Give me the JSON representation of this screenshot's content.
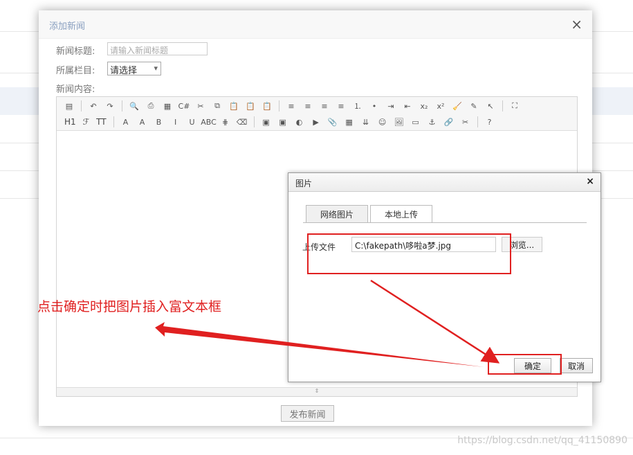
{
  "modal": {
    "title": "添加新闻",
    "close": "×",
    "title_label": "新闻标题:",
    "title_placeholder": "请输入新闻标题",
    "category_label": "所属栏目:",
    "category_selected": "请选择",
    "content_label": "新闻内容:",
    "submit_label": "发布新闻"
  },
  "toolbar": {
    "row1_icons": [
      "source-icon",
      "undo-icon",
      "redo-icon",
      "preview-icon",
      "print-icon",
      "template-icon",
      "code-icon",
      "cut-icon",
      "copy-icon",
      "paste-icon",
      "paste-text-icon",
      "paste-word-icon",
      "align-left-icon",
      "align-center-icon",
      "align-right-icon",
      "justify-icon",
      "ordered-list-icon",
      "unordered-list-icon",
      "indent-icon",
      "outdent-icon",
      "subscript-icon",
      "superscript-icon",
      "clear-format-icon",
      "select-all-icon",
      "pointer-icon",
      "fullscreen-icon"
    ],
    "row1_glyphs": [
      "▤",
      "↶",
      "↷",
      "🔍",
      "⎙",
      "▦",
      "C#",
      "✂",
      "⧉",
      "📋",
      "📋",
      "📋",
      "≡",
      "≡",
      "≡",
      "≡",
      "⒈",
      "•",
      "⇥",
      "⇤",
      "x₂",
      "x²",
      "🧹",
      "✎",
      "↖",
      "⛶"
    ],
    "heading": "H1",
    "font": "ℱ",
    "size": "TT",
    "row2_icons": [
      "font-color-icon",
      "highlight-icon",
      "bold-icon",
      "italic-icon",
      "underline-icon",
      "strikethrough-icon",
      "line-height-icon",
      "eraser-icon",
      "image-icon",
      "multi-image-icon",
      "flash-icon",
      "media-icon",
      "attach-icon",
      "table-icon",
      "insert-row-icon",
      "emoticon-icon",
      "image-gallery-icon",
      "pagebreak-icon",
      "anchor-icon",
      "link-icon",
      "unlink-icon",
      "help-icon"
    ],
    "row2_glyphs": [
      "A",
      "A",
      "B",
      "I",
      "U",
      "ABC",
      "⋕",
      "⌫",
      "▣",
      "▣",
      "◐",
      "▶",
      "📎",
      "▦",
      "⇊",
      "☺",
      "🖼",
      "▭",
      "⚓",
      "🔗",
      "✂",
      "?"
    ]
  },
  "image_dialog": {
    "title": "图片",
    "close": "×",
    "tabs": [
      "网络图片",
      "本地上传"
    ],
    "upload_label": "上传文件",
    "file_path": "C:\\fakepath\\哆啦a梦.jpg",
    "browse_label": "浏览...",
    "ok_label": "确定",
    "cancel_label": "取消"
  },
  "annotation": {
    "text": "点击确定时把图片插入富文本框",
    "color": "#e02020"
  },
  "watermark": "https://blog.csdn.net/qq_41150890"
}
